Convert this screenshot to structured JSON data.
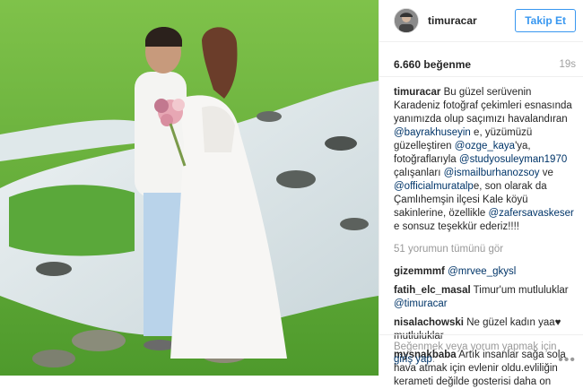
{
  "post": {
    "username": "timuracar",
    "follow_label": "Takip Et",
    "likes": "6.660 beğenme",
    "time_ago": "19s",
    "caption": {
      "author": "timuracar",
      "text_1": "Bu güzel serüvenin Karadeniz fotoğraf çekimleri esnasında yanımızda olup saçımızı havalandıran",
      "mention_1": "@bayrakhuseyin",
      "text_2": "e, yüzümüzü güzelleştiren",
      "mention_2": "@ozge_kaya",
      "text_3": "'ya, fotoğraflarıyla",
      "mention_3": "@studyosuleyman1970",
      "text_4": "çalışanları",
      "mention_4": "@ismailburhanozsoy",
      "text_5": "ve",
      "mention_5": "@officialmuratalp",
      "text_6": "e, son olarak da Çamlıhemşin ilçesi Kale köyü sakinlerine, özellikle",
      "mention_6": "@zafersavaskeser",
      "text_7": "e sonsuz teşekkür ederiz!!!!"
    },
    "view_all_comments": "51 yorumun tümünü gör",
    "comments": [
      {
        "user": "gizemmmf",
        "mention": "@mrvee_gkysl",
        "text": ""
      },
      {
        "user": "fatih_elc_masal",
        "mention": "",
        "text": "Timur'um mutluluklar"
      },
      {
        "user": "",
        "mention": "@timuracar",
        "text": ""
      },
      {
        "user": "nisalachowski",
        "mention": "",
        "text": "Ne güzel kadın yaa♥ mutluluklar"
      },
      {
        "user": "mysnakbaba",
        "mention": "",
        "text": "Artık insanlar sağa sola hava atmak için evlenir oldu.evliliğin kerameti değilde gosterisi daha on"
      }
    ],
    "footer": {
      "prompt": "Beğenmek veya yorum yapmak için",
      "login": "giriş yap",
      "after": ".",
      "more_icon": "ellipsis-icon"
    }
  },
  "colors": {
    "accent": "#3897f0",
    "link": "#003569",
    "muted": "#999999",
    "text": "#262626"
  }
}
